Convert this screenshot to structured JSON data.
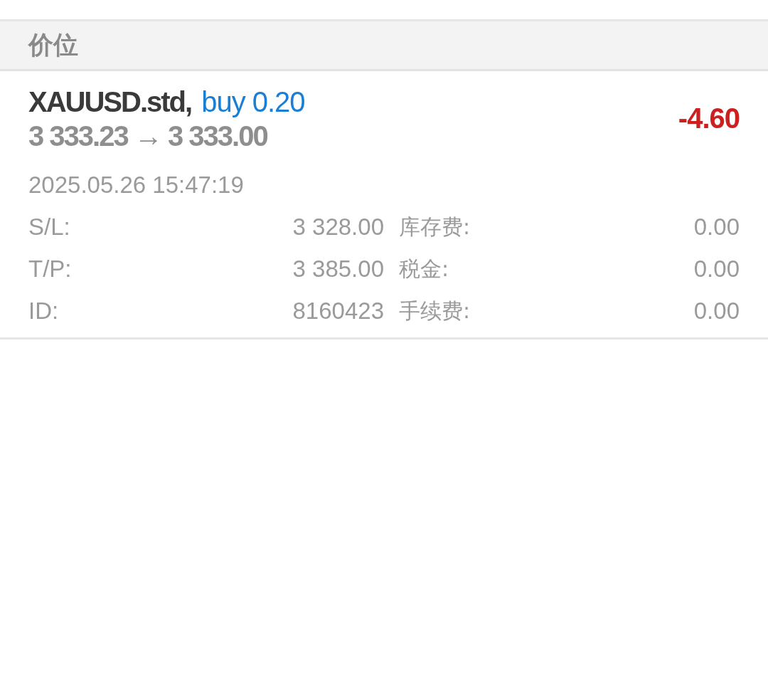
{
  "header": {
    "title": "价位"
  },
  "position": {
    "symbol": "XAUUSD.std,",
    "order": "buy 0.20",
    "prices": "3 333.23 → 3 333.00",
    "profit": "-4.60",
    "time": "2025.05.26 15:47:19",
    "details": [
      {
        "label": "S/L:",
        "value": "3 328.00",
        "label_2": "库存费:",
        "value_2": "0.00"
      },
      {
        "label": "T/P:",
        "value": "3 385.00",
        "label_2": "税金:",
        "value_2": "0.00"
      },
      {
        "label": "ID:",
        "value": "8160423",
        "label_2": "手续费:",
        "value_2": "0.00"
      }
    ]
  }
}
